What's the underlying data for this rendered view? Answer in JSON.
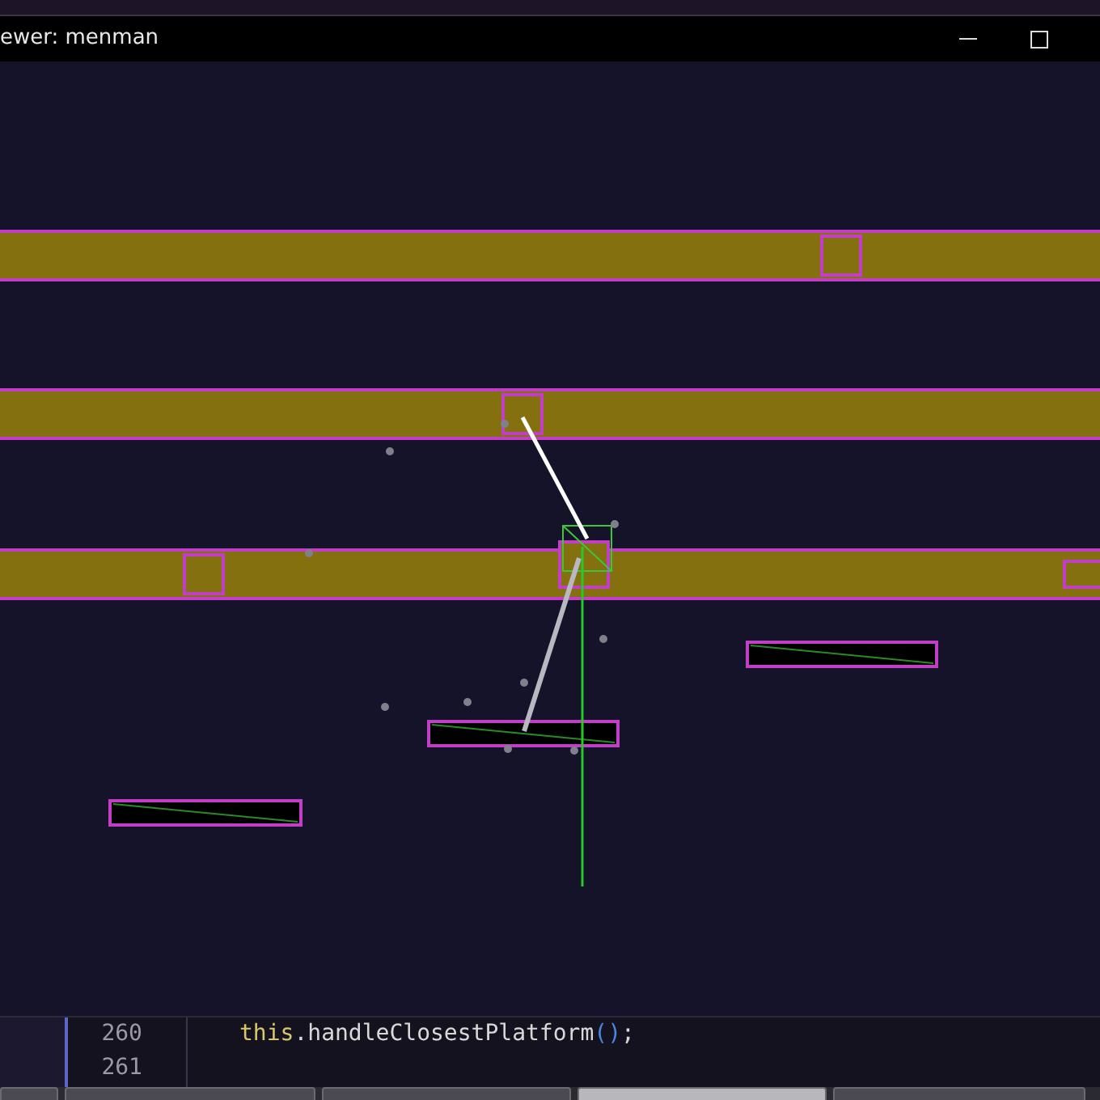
{
  "window": {
    "title": "ewer: menman"
  },
  "editor": {
    "lines": [
      {
        "number": "260",
        "tokens": [
          {
            "text": "this",
            "kind": "keyword"
          },
          {
            "text": ".handleClosestPlatform",
            "kind": "plain"
          },
          {
            "text": "()",
            "kind": "paren"
          },
          {
            "text": ";",
            "kind": "plain"
          }
        ]
      },
      {
        "number": "261"
      }
    ]
  },
  "bottom_tabs": [
    {
      "selected": false
    },
    {
      "selected": false
    },
    {
      "selected": false
    },
    {
      "selected": true
    },
    {
      "selected": false
    }
  ]
}
